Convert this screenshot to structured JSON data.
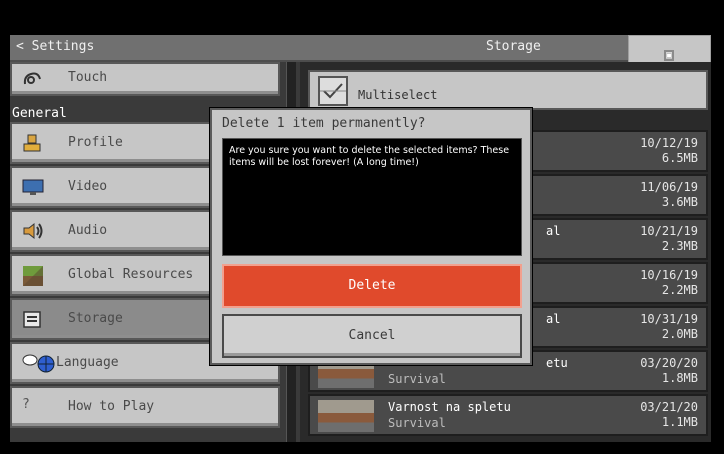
{
  "header": {
    "back_label": "< Settings",
    "title": "Storage"
  },
  "sidebar": {
    "partial_item": {
      "label": "Touch",
      "icon": "touch-icon"
    },
    "section_label": "General",
    "items": [
      {
        "label": "Profile",
        "icon": "profile-icon"
      },
      {
        "label": "Video",
        "icon": "monitor-icon"
      },
      {
        "label": "Audio",
        "icon": "speaker-icon"
      },
      {
        "label": "Global Resources",
        "icon": "resource-pack-icon"
      },
      {
        "label": "Storage",
        "icon": "folder-icon",
        "selected": true
      },
      {
        "label": "Language",
        "icon": "globe-icon"
      },
      {
        "label": "How to Play",
        "icon": "question-icon"
      }
    ]
  },
  "main": {
    "multiselect_label": "Multiselect",
    "rows": [
      {
        "name": "",
        "mode": "",
        "date": "10/12/19",
        "size": "6.5MB"
      },
      {
        "name": "",
        "mode": "",
        "date": "11/06/19",
        "size": "3.6MB"
      },
      {
        "name": "al",
        "mode": "",
        "date": "10/21/19",
        "size": "2.3MB"
      },
      {
        "name": "",
        "mode": "",
        "date": "10/16/19",
        "size": "2.2MB"
      },
      {
        "name": "al",
        "mode": "",
        "date": "10/31/19",
        "size": "2.0MB"
      },
      {
        "name": "etu",
        "mode": "Survival",
        "date": "03/20/20",
        "size": "1.8MB"
      },
      {
        "name": "Varnost na spletu",
        "mode": "Survival",
        "date": "03/21/20",
        "size": "1.1MB"
      }
    ]
  },
  "dialog": {
    "title": "Delete 1 item permanently?",
    "message": "Are you sure you want to delete the selected items? These items will be lost forever! (A long time!)",
    "delete_label": "Delete",
    "cancel_label": "Cancel"
  },
  "colors": {
    "delete": "#e04a2c",
    "panel": "#c6c6c6",
    "header": "#707070"
  }
}
